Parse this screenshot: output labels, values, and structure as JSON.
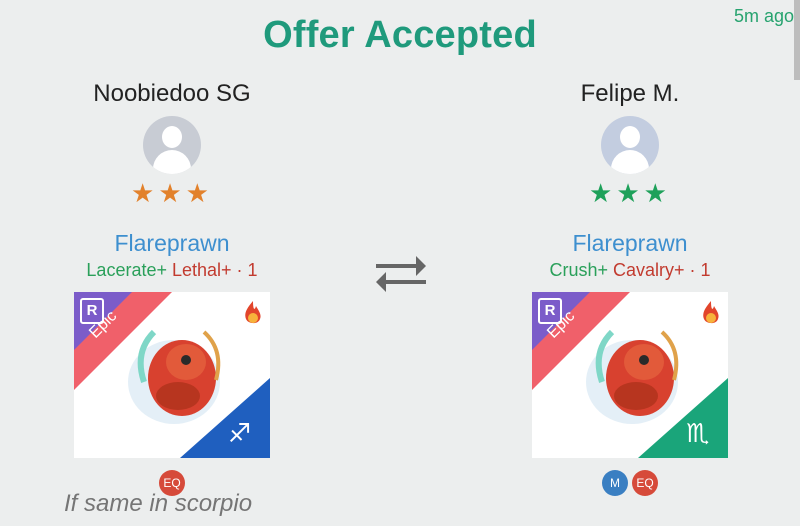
{
  "header": {
    "title": "Offer Accepted",
    "timestamp": "5m ago"
  },
  "trade": {
    "left": {
      "username": "Noobiedoo SG",
      "stars": "★★★",
      "star_color": "#e2812b",
      "pet_name": "Flareprawn",
      "trait_primary": "Lacerate+",
      "trait_secondary": "Lethal+ · 1",
      "rarity_badge": "R",
      "rarity": "Epic",
      "zodiac_symbol": "♐",
      "zodiac_color": "#1f5fbf",
      "element_icons": [
        "fire-icon",
        "wind-icon"
      ],
      "badges": [
        "EQ"
      ]
    },
    "right": {
      "username": "Felipe M.",
      "stars": "★★★",
      "star_color": "#1ea15a",
      "pet_name": "Flareprawn",
      "trait_primary": "Crush+",
      "trait_secondary": "Cavalry+ · 1",
      "rarity_badge": "R",
      "rarity": "Epic",
      "zodiac_symbol": "♏",
      "zodiac_color": "#1aa57a",
      "element_icons": [
        "fire-icon",
        "wind-icon"
      ],
      "badges": [
        "M",
        "EQ"
      ]
    }
  },
  "swap_icon": "swap-arrows-icon",
  "comment": "If same in scorpio"
}
